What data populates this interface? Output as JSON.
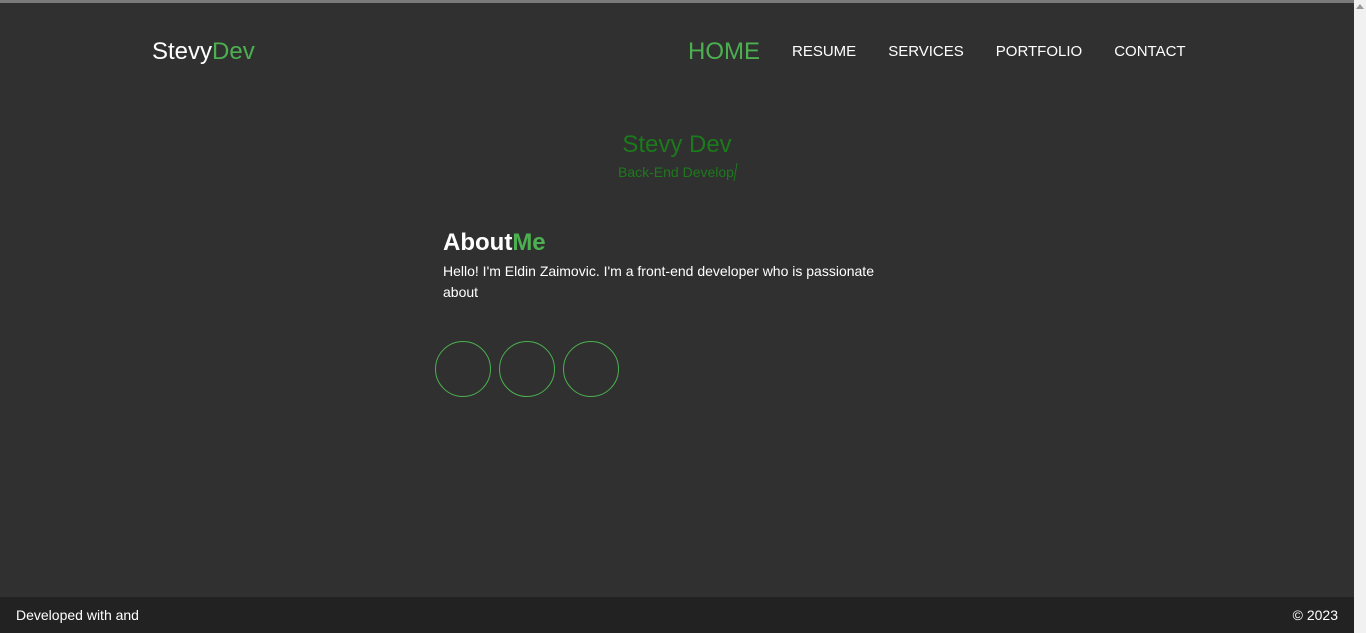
{
  "brand": {
    "name_main": "Stevy",
    "name_accent": "Dev"
  },
  "nav": {
    "items": [
      {
        "label": "HOME",
        "active": true
      },
      {
        "label": "RESUME",
        "active": false
      },
      {
        "label": "SERVICES",
        "active": false
      },
      {
        "label": "PORTFOLIO",
        "active": false
      },
      {
        "label": "CONTACT",
        "active": false
      }
    ]
  },
  "hero": {
    "name": "Stevy Dev",
    "role_typed": "Back-End Develop"
  },
  "about": {
    "title_main": "About",
    "title_accent": "Me",
    "text": "Hello! I'm Eldin Zaimovic. I'm a front-end developer who is passionate about"
  },
  "footer": {
    "left_text": "Developed with  and",
    "right_text": "© 2023"
  },
  "colors": {
    "background": "#303030",
    "accent": "#4caf50",
    "hero_accent": "#1b7a1b",
    "footer_bg": "#222222"
  }
}
